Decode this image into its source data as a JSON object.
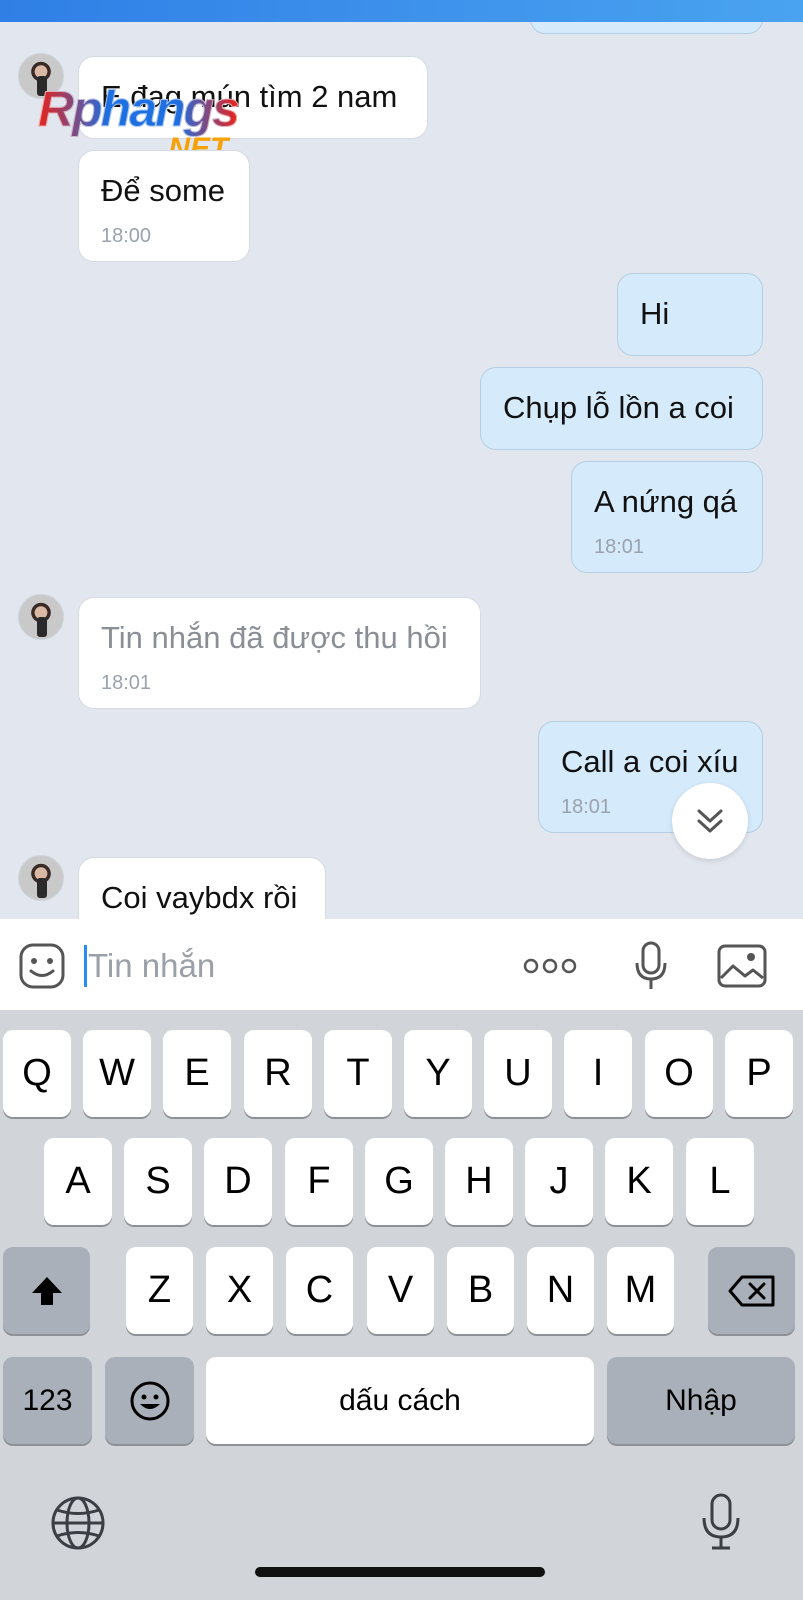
{
  "chat": {
    "watermark": {
      "main": "Rphangs",
      "sub": ".NET"
    },
    "messages": [
      {
        "direction": "in",
        "text": "E đag mún tìm 2 nam",
        "time": ""
      },
      {
        "direction": "in",
        "text": "Để some",
        "time": "18:00"
      },
      {
        "direction": "out",
        "text": "Hi",
        "time": ""
      },
      {
        "direction": "out",
        "text": "Chụp lỗ lồn a coi",
        "time": ""
      },
      {
        "direction": "out",
        "text": "A nứng qá",
        "time": "18:01"
      },
      {
        "direction": "in",
        "text": "Tin nhắn đã được thu hồi",
        "time": "18:01",
        "recalled": true
      },
      {
        "direction": "out",
        "text": "Call a coi xíu",
        "time": "18:01"
      },
      {
        "direction": "in",
        "text": "Coi vaybdx rồi",
        "time": ""
      }
    ],
    "scroll_down_icon": "double-chevron-down-icon"
  },
  "composer": {
    "placeholder": "Tin nhắn",
    "sticker_icon": "sticker-icon",
    "more_icon": "more-dots-icon",
    "mic_icon": "microphone-icon",
    "image_icon": "image-icon"
  },
  "keyboard": {
    "row1": [
      "Q",
      "W",
      "E",
      "R",
      "T",
      "Y",
      "U",
      "I",
      "O",
      "P"
    ],
    "row2": [
      "A",
      "S",
      "D",
      "F",
      "G",
      "H",
      "J",
      "K",
      "L"
    ],
    "row3": [
      "Z",
      "X",
      "C",
      "V",
      "B",
      "N",
      "M"
    ],
    "numbers_label": "123",
    "space_label": "dấu cách",
    "return_label": "Nhập",
    "shift_icon": "shift-icon",
    "backspace_icon": "backspace-icon",
    "emoji_icon": "emoji-icon",
    "globe_icon": "globe-icon",
    "dictation_icon": "microphone-icon"
  },
  "colors": {
    "accent": "#2d8cf0",
    "incoming_bubble": "#ffffff",
    "outgoing_bubble": "#d5eafa",
    "chat_background": "#e2e7ef",
    "keyboard_background": "#d1d4d9"
  }
}
